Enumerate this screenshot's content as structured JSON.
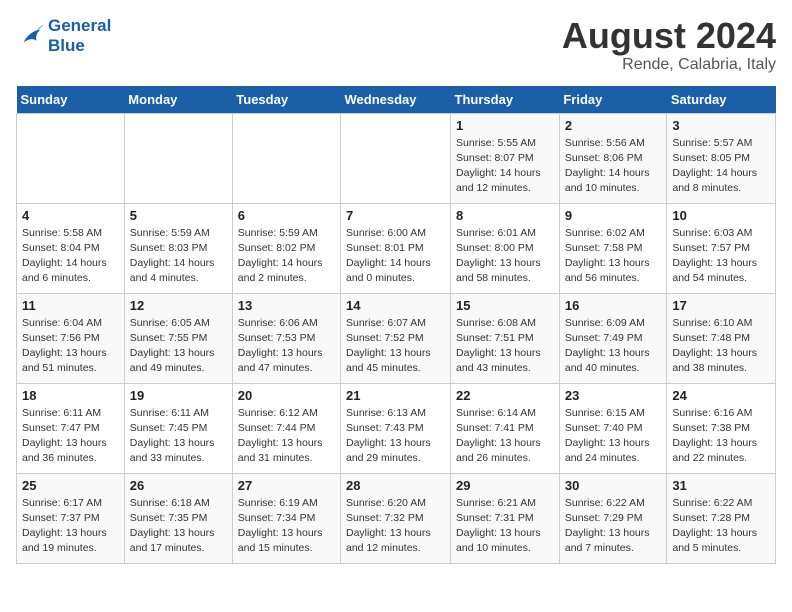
{
  "header": {
    "logo_line1": "General",
    "logo_line2": "Blue",
    "month": "August 2024",
    "location": "Rende, Calabria, Italy"
  },
  "days_of_week": [
    "Sunday",
    "Monday",
    "Tuesday",
    "Wednesday",
    "Thursday",
    "Friday",
    "Saturday"
  ],
  "weeks": [
    [
      {
        "day": "",
        "info": ""
      },
      {
        "day": "",
        "info": ""
      },
      {
        "day": "",
        "info": ""
      },
      {
        "day": "",
        "info": ""
      },
      {
        "day": "1",
        "info": "Sunrise: 5:55 AM\nSunset: 8:07 PM\nDaylight: 14 hours\nand 12 minutes."
      },
      {
        "day": "2",
        "info": "Sunrise: 5:56 AM\nSunset: 8:06 PM\nDaylight: 14 hours\nand 10 minutes."
      },
      {
        "day": "3",
        "info": "Sunrise: 5:57 AM\nSunset: 8:05 PM\nDaylight: 14 hours\nand 8 minutes."
      }
    ],
    [
      {
        "day": "4",
        "info": "Sunrise: 5:58 AM\nSunset: 8:04 PM\nDaylight: 14 hours\nand 6 minutes."
      },
      {
        "day": "5",
        "info": "Sunrise: 5:59 AM\nSunset: 8:03 PM\nDaylight: 14 hours\nand 4 minutes."
      },
      {
        "day": "6",
        "info": "Sunrise: 5:59 AM\nSunset: 8:02 PM\nDaylight: 14 hours\nand 2 minutes."
      },
      {
        "day": "7",
        "info": "Sunrise: 6:00 AM\nSunset: 8:01 PM\nDaylight: 14 hours\nand 0 minutes."
      },
      {
        "day": "8",
        "info": "Sunrise: 6:01 AM\nSunset: 8:00 PM\nDaylight: 13 hours\nand 58 minutes."
      },
      {
        "day": "9",
        "info": "Sunrise: 6:02 AM\nSunset: 7:58 PM\nDaylight: 13 hours\nand 56 minutes."
      },
      {
        "day": "10",
        "info": "Sunrise: 6:03 AM\nSunset: 7:57 PM\nDaylight: 13 hours\nand 54 minutes."
      }
    ],
    [
      {
        "day": "11",
        "info": "Sunrise: 6:04 AM\nSunset: 7:56 PM\nDaylight: 13 hours\nand 51 minutes."
      },
      {
        "day": "12",
        "info": "Sunrise: 6:05 AM\nSunset: 7:55 PM\nDaylight: 13 hours\nand 49 minutes."
      },
      {
        "day": "13",
        "info": "Sunrise: 6:06 AM\nSunset: 7:53 PM\nDaylight: 13 hours\nand 47 minutes."
      },
      {
        "day": "14",
        "info": "Sunrise: 6:07 AM\nSunset: 7:52 PM\nDaylight: 13 hours\nand 45 minutes."
      },
      {
        "day": "15",
        "info": "Sunrise: 6:08 AM\nSunset: 7:51 PM\nDaylight: 13 hours\nand 43 minutes."
      },
      {
        "day": "16",
        "info": "Sunrise: 6:09 AM\nSunset: 7:49 PM\nDaylight: 13 hours\nand 40 minutes."
      },
      {
        "day": "17",
        "info": "Sunrise: 6:10 AM\nSunset: 7:48 PM\nDaylight: 13 hours\nand 38 minutes."
      }
    ],
    [
      {
        "day": "18",
        "info": "Sunrise: 6:11 AM\nSunset: 7:47 PM\nDaylight: 13 hours\nand 36 minutes."
      },
      {
        "day": "19",
        "info": "Sunrise: 6:11 AM\nSunset: 7:45 PM\nDaylight: 13 hours\nand 33 minutes."
      },
      {
        "day": "20",
        "info": "Sunrise: 6:12 AM\nSunset: 7:44 PM\nDaylight: 13 hours\nand 31 minutes."
      },
      {
        "day": "21",
        "info": "Sunrise: 6:13 AM\nSunset: 7:43 PM\nDaylight: 13 hours\nand 29 minutes."
      },
      {
        "day": "22",
        "info": "Sunrise: 6:14 AM\nSunset: 7:41 PM\nDaylight: 13 hours\nand 26 minutes."
      },
      {
        "day": "23",
        "info": "Sunrise: 6:15 AM\nSunset: 7:40 PM\nDaylight: 13 hours\nand 24 minutes."
      },
      {
        "day": "24",
        "info": "Sunrise: 6:16 AM\nSunset: 7:38 PM\nDaylight: 13 hours\nand 22 minutes."
      }
    ],
    [
      {
        "day": "25",
        "info": "Sunrise: 6:17 AM\nSunset: 7:37 PM\nDaylight: 13 hours\nand 19 minutes."
      },
      {
        "day": "26",
        "info": "Sunrise: 6:18 AM\nSunset: 7:35 PM\nDaylight: 13 hours\nand 17 minutes."
      },
      {
        "day": "27",
        "info": "Sunrise: 6:19 AM\nSunset: 7:34 PM\nDaylight: 13 hours\nand 15 minutes."
      },
      {
        "day": "28",
        "info": "Sunrise: 6:20 AM\nSunset: 7:32 PM\nDaylight: 13 hours\nand 12 minutes."
      },
      {
        "day": "29",
        "info": "Sunrise: 6:21 AM\nSunset: 7:31 PM\nDaylight: 13 hours\nand 10 minutes."
      },
      {
        "day": "30",
        "info": "Sunrise: 6:22 AM\nSunset: 7:29 PM\nDaylight: 13 hours\nand 7 minutes."
      },
      {
        "day": "31",
        "info": "Sunrise: 6:22 AM\nSunset: 7:28 PM\nDaylight: 13 hours\nand 5 minutes."
      }
    ]
  ]
}
